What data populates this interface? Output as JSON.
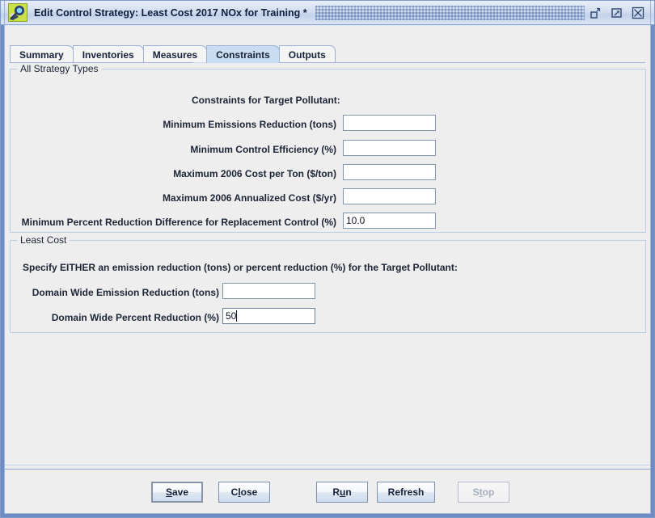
{
  "window": {
    "title": "Edit Control Strategy: Least Cost 2017 NOx for Training *",
    "icon": "app-icon",
    "controls": {
      "restore_label": "restore-icon",
      "maximize_label": "maximize-icon",
      "close_label": "close-icon"
    }
  },
  "tabs": [
    {
      "label": "Summary",
      "selected": false
    },
    {
      "label": "Inventories",
      "selected": false
    },
    {
      "label": "Measures",
      "selected": false
    },
    {
      "label": "Constraints",
      "selected": true
    },
    {
      "label": "Outputs",
      "selected": false
    }
  ],
  "all_strategy_types": {
    "title": "All Strategy Types",
    "header": "Constraints for Target Pollutant:",
    "fields": [
      {
        "label": "Minimum Emissions Reduction (tons)",
        "value": "",
        "name": "minimum-emissions-reduction"
      },
      {
        "label": "Minimum Control Efficiency (%)",
        "value": "",
        "name": "minimum-control-efficiency"
      },
      {
        "label": "Maximum 2006 Cost per Ton ($/ton)",
        "value": "",
        "name": "maximum-cost-per-ton"
      },
      {
        "label": "Maximum 2006 Annualized Cost ($/yr)",
        "value": "",
        "name": "maximum-annualized-cost"
      },
      {
        "label": "Minimum Percent Reduction Difference for Replacement Control (%)",
        "value": "10.0",
        "name": "minimum-percent-reduction-difference"
      }
    ]
  },
  "least_cost": {
    "title": "Least Cost",
    "header": "Specify EITHER an emission reduction (tons) or percent reduction (%) for the Target Pollutant:",
    "fields": [
      {
        "label": "Domain Wide Emission Reduction (tons)",
        "value": "",
        "name": "domain-wide-emission-reduction"
      },
      {
        "label": "Domain Wide Percent Reduction (%)",
        "value": "50",
        "name": "domain-wide-percent-reduction"
      }
    ]
  },
  "footer": {
    "buttons": [
      {
        "label": "Save",
        "mnemonic": "S",
        "state": "default",
        "name": "save-button"
      },
      {
        "label": "Close",
        "mnemonic": "l",
        "state": "normal",
        "name": "close-button"
      },
      {
        "label": "Run",
        "mnemonic": "u",
        "state": "normal",
        "name": "run-button"
      },
      {
        "label": "Refresh",
        "mnemonic": "",
        "state": "normal",
        "name": "refresh-button"
      },
      {
        "label": "Stop",
        "mnemonic": "t",
        "state": "disabled",
        "name": "stop-button"
      }
    ]
  },
  "colors": {
    "frame_blue": "#6e8cc4",
    "panel_bg": "#eeeeee",
    "tab_selected": "#c8ddf1",
    "group_border": "#b9cde4",
    "field_border": "#8395ad",
    "icon_green": "#c9e24a"
  }
}
